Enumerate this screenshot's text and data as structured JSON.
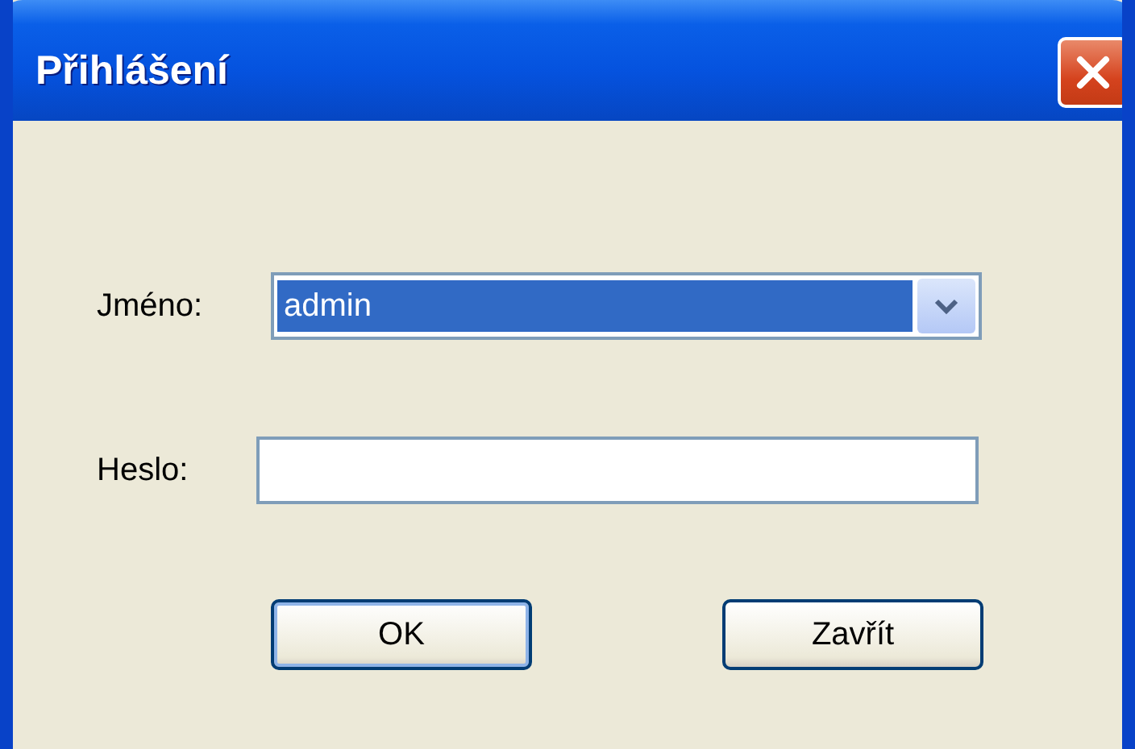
{
  "window": {
    "title": "Přihlášení"
  },
  "fields": [
    {
      "kind": "combo",
      "label": "Jméno:",
      "value": "admin",
      "selected": true
    },
    {
      "kind": "text",
      "label": "Heslo:"
    }
  ],
  "buttons": [
    {
      "label": "OK",
      "default": true
    },
    {
      "label": "Zavřít",
      "default": false
    }
  ]
}
